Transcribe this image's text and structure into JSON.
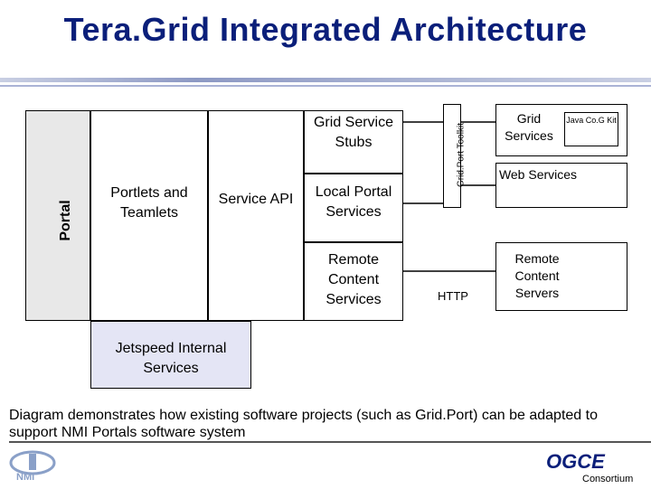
{
  "title": "Tera.Grid Integrated Architecture",
  "portal_label": "Portal",
  "portlets_label": "Portlets and Teamlets",
  "service_api_label": "Service API",
  "grid_service_stubs_label": "Grid Service Stubs",
  "local_portal_services_label": "Local Portal Services",
  "remote_content_services_label": "Remote Content Services",
  "gridport_toolkit_label": "Grid.Port Toolkit",
  "grid_services_label": "Grid Services",
  "java_cog_kit_label": "Java Co.G Kit",
  "web_services_label": "Web Services",
  "http_label": "HTTP",
  "remote_content_servers_label": "Remote Content Servers",
  "jetspeed_label": "Jetspeed Internal Services",
  "caption": "Diagram demonstrates how existing software projects (such as Grid.Port) can be adapted to support NMI Portals software system",
  "logo_left": "NMI",
  "logo_right": "OGCE",
  "logo_right_sub": "Consortium",
  "colors": {
    "title": "#0b1f7a",
    "jetspeed_fill": "#e4e5f5",
    "portal_fill": "#e8e8e8"
  }
}
